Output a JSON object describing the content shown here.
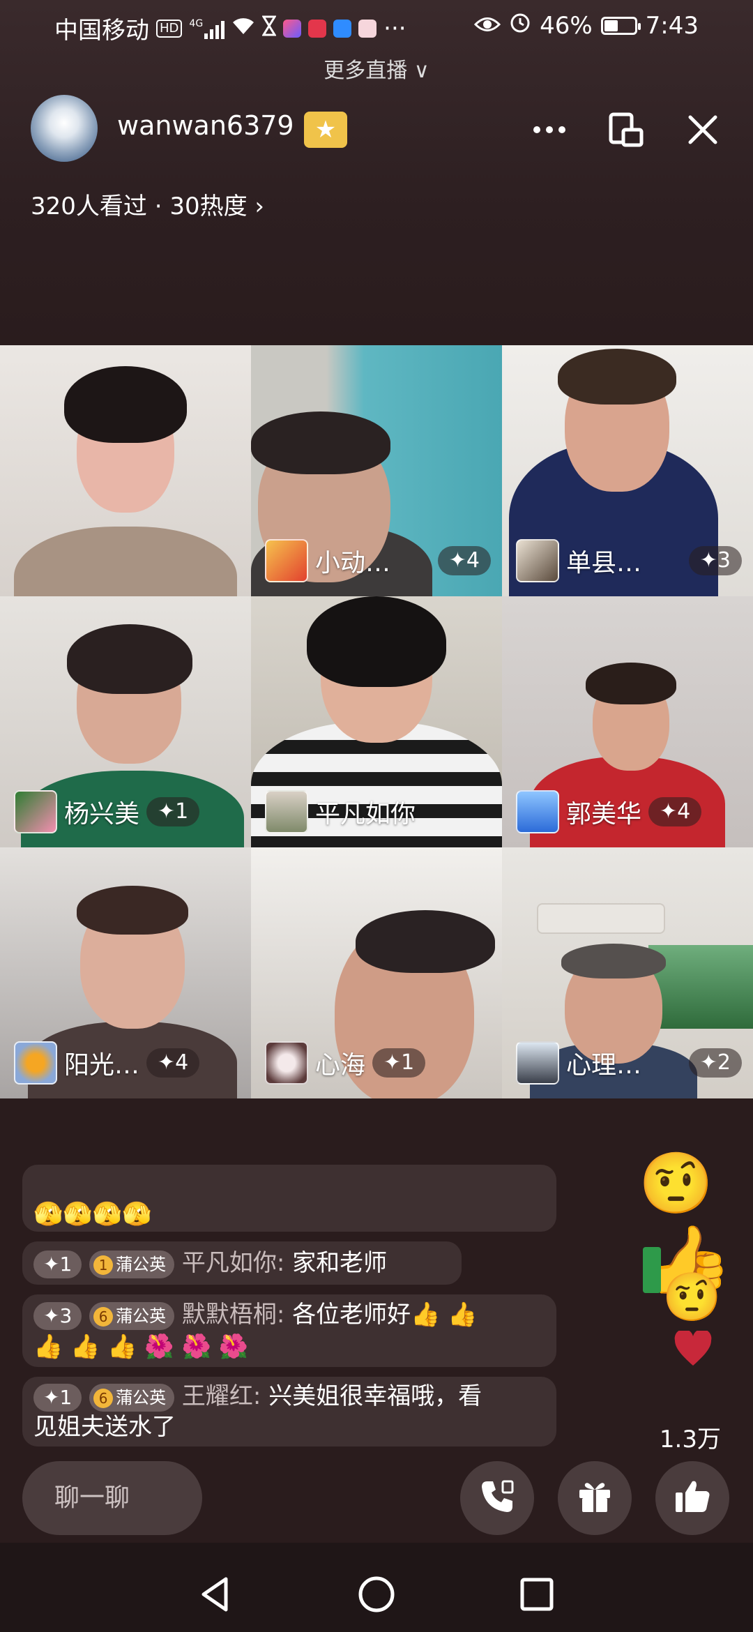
{
  "status_bar": {
    "carrier": "中国移动",
    "hd": "HD",
    "network": "4G",
    "more": "···",
    "battery": "46%",
    "battery_level": 0.46,
    "time": "7:43"
  },
  "header": {
    "more_live": "更多直播 ∨",
    "host_name": "wanwan6379",
    "badge_icon": "star-badge-icon",
    "viewer_info": "320人看过 · 30热度 ›"
  },
  "tiles": [
    {
      "name": "",
      "count": ""
    },
    {
      "name": "小动…",
      "count": "✦4"
    },
    {
      "name": "单县…",
      "count": "✦3"
    },
    {
      "name": "杨兴美",
      "count": "✦1"
    },
    {
      "name": "平凡如你",
      "count": ""
    },
    {
      "name": "郭美华",
      "count": "✦4"
    },
    {
      "name": "阳光…",
      "count": "✦4"
    },
    {
      "name": "心海",
      "count": "✦1"
    },
    {
      "name": "心理…",
      "count": "✦2"
    }
  ],
  "chat": {
    "partial_line": "🫣🫣🫣🫣",
    "messages": [
      {
        "level": "✦1",
        "fan_level": "1",
        "fan_club": "蒲公英",
        "sender": "平凡如你:",
        "text": "家和老师"
      },
      {
        "level": "✦3",
        "fan_level": "6",
        "fan_club": "蒲公英",
        "sender": "默默梧桐:",
        "text": "各位老师好👍 👍",
        "text2": "👍 👍 👍 🌺 🌺 🌺"
      },
      {
        "level": "✦1",
        "fan_level": "6",
        "fan_club": "蒲公英",
        "sender": "王耀红:",
        "text": "兴美姐很幸福哦，看",
        "text2": "见姐夫送水了"
      }
    ]
  },
  "likes": "1.3万",
  "bottom": {
    "chat_placeholder": "聊一聊"
  },
  "colors": {
    "background": "#2a1c1d",
    "badge": "#f0c34a",
    "heart": "#c8283a"
  }
}
